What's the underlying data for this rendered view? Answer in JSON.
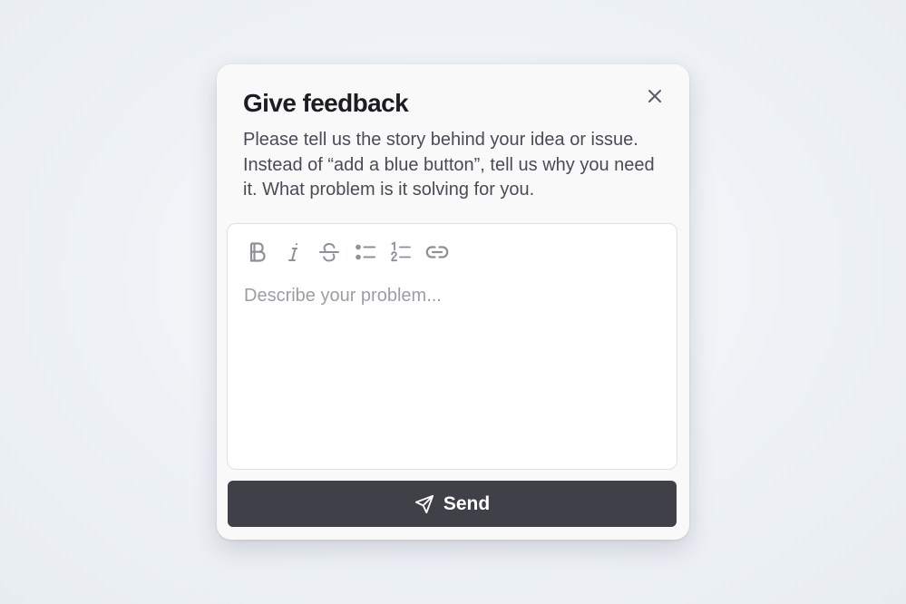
{
  "dialog": {
    "title": "Give feedback",
    "description": "Please tell us the story behind your idea or issue. Instead of “add a blue button”, tell us why you need it. What problem is it solving for you.",
    "close_icon": "close-icon"
  },
  "editor": {
    "toolbar": [
      {
        "name": "bold",
        "icon": "bold-icon"
      },
      {
        "name": "italic",
        "icon": "italic-icon"
      },
      {
        "name": "strikethrough",
        "icon": "strikethrough-icon"
      },
      {
        "name": "bullet-list",
        "icon": "bullet-list-icon"
      },
      {
        "name": "numbered-list",
        "icon": "numbered-list-icon"
      },
      {
        "name": "link",
        "icon": "link-icon"
      }
    ],
    "value": "",
    "placeholder": "Describe your problem..."
  },
  "send_button": {
    "label": "Send",
    "icon": "send-icon"
  },
  "colors": {
    "button_bg": "#3f4048",
    "title_text": "#1d1d20",
    "body_text": "#4a4c55",
    "icon_gray": "#8e9098",
    "placeholder": "#9c9ea6"
  }
}
